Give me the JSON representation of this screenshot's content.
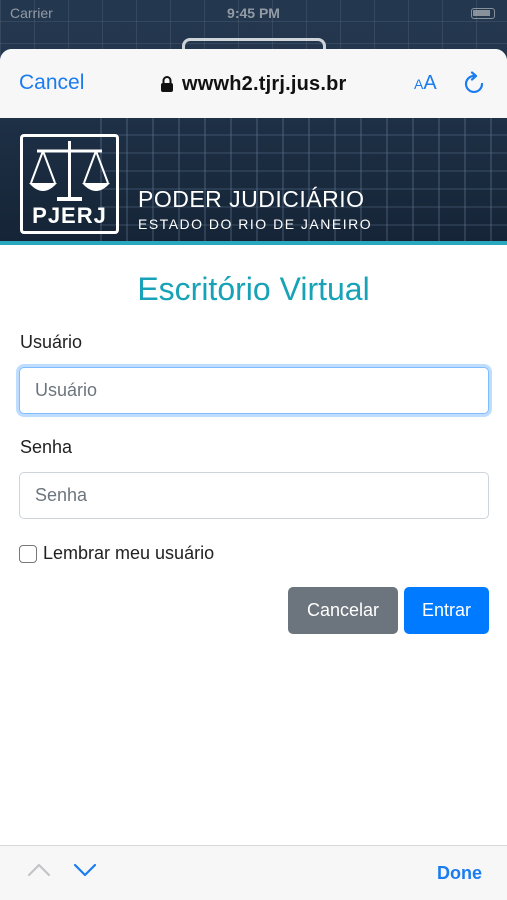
{
  "status_bar": {
    "carrier": "Carrier",
    "time": "9:45 PM"
  },
  "browser": {
    "cancel_label": "Cancel",
    "url": "wwwh2.tjrj.jus.br",
    "text_size_label_small": "A",
    "text_size_label_large": "A"
  },
  "banner": {
    "logo_text": "PJERJ",
    "title": "PODER JUDICIÁRIO",
    "subtitle": "ESTADO DO RIO DE JANEIRO"
  },
  "form": {
    "heading": "Escritório Virtual",
    "user_label": "Usuário",
    "user_placeholder": "Usuário",
    "user_value": "",
    "password_label": "Senha",
    "password_placeholder": "Senha",
    "password_value": "",
    "remember_label": "Lembrar meu usuário",
    "remember_checked": false,
    "cancel_button": "Cancelar",
    "submit_button": "Entrar"
  },
  "toolbar": {
    "done_label": "Done"
  },
  "colors": {
    "accent": "#17a2b8",
    "ios_blue": "#1a7cf0",
    "primary_button": "#007bff",
    "secondary_button": "#6c757d"
  }
}
